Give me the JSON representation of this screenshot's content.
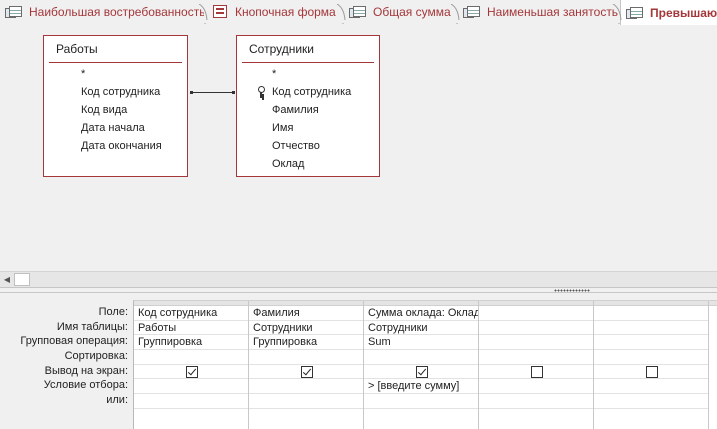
{
  "tabs": [
    {
      "label": "Наибольшая востребованность",
      "icon": "query-icon"
    },
    {
      "label": "Кнопочная форма",
      "icon": "form-icon"
    },
    {
      "label": "Общая сумма",
      "icon": "query-icon"
    },
    {
      "label": "Наименьшая занятость",
      "icon": "query-icon"
    },
    {
      "label": "Превышающ",
      "icon": "query-icon",
      "active": true
    }
  ],
  "design": {
    "tables": [
      {
        "title": "Работы",
        "fields": [
          "*",
          "Код сотрудника",
          "Код вида",
          "Дата начала",
          "Дата окончания"
        ]
      },
      {
        "title": "Сотрудники",
        "fields": [
          "*",
          "Код сотрудника",
          "Фамилия",
          "Имя",
          "Отчество",
          "Оклад"
        ],
        "key_field_index": 1
      }
    ]
  },
  "qbe": {
    "row_labels": [
      "Поле:",
      "Имя таблицы:",
      "Групповая операция:",
      "Сортировка:",
      "Вывод на экран:",
      "Условие отбора:",
      "или:"
    ],
    "columns": [
      {
        "field": "Код сотрудника",
        "table": "Работы",
        "total": "Группировка",
        "sort": "",
        "show": true,
        "criteria": "",
        "or": ""
      },
      {
        "field": "Фамилия",
        "table": "Сотрудники",
        "total": "Группировка",
        "sort": "",
        "show": true,
        "criteria": "",
        "or": ""
      },
      {
        "field": "Сумма оклада: Оклад",
        "table": "Сотрудники",
        "total": "Sum",
        "sort": "",
        "show": true,
        "criteria": "> [введите сумму]",
        "or": ""
      },
      {
        "field": "",
        "table": "",
        "total": "",
        "sort": "",
        "show": false,
        "criteria": "",
        "or": ""
      },
      {
        "field": "",
        "table": "",
        "total": "",
        "sort": "",
        "show": false,
        "criteria": "",
        "or": ""
      }
    ]
  },
  "colors": {
    "accent": "#a4373a",
    "background": "#f0f0f0"
  }
}
